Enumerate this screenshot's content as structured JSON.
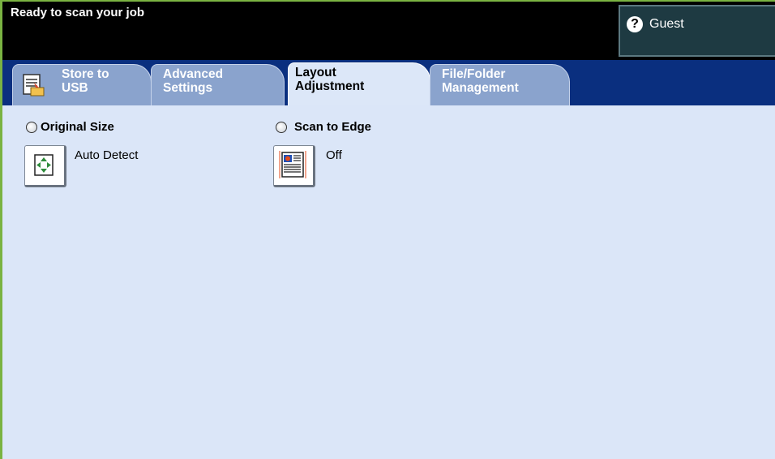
{
  "status_message": "Ready to scan your job",
  "user": {
    "label": "Guest",
    "icon": "help-key-icon"
  },
  "tabs": [
    {
      "label": "Store to\nUSB",
      "active": false,
      "icon": "usb-store-icon"
    },
    {
      "label": "Advanced\nSettings",
      "active": false
    },
    {
      "label": "Layout\nAdjustment",
      "active": true
    },
    {
      "label": "File/Folder\nManagement",
      "active": false
    }
  ],
  "original_size": {
    "title": "Original Size",
    "value": "Auto Detect",
    "icon": "auto-detect-icon"
  },
  "scan_to_edge": {
    "title": "Scan to Edge",
    "value": "Off",
    "icon": "scan-to-edge-icon"
  },
  "colors": {
    "header": "#000000",
    "tab_bar": "#0a2f7f",
    "content": "#dbe6f8",
    "frame": "#7ab342"
  }
}
